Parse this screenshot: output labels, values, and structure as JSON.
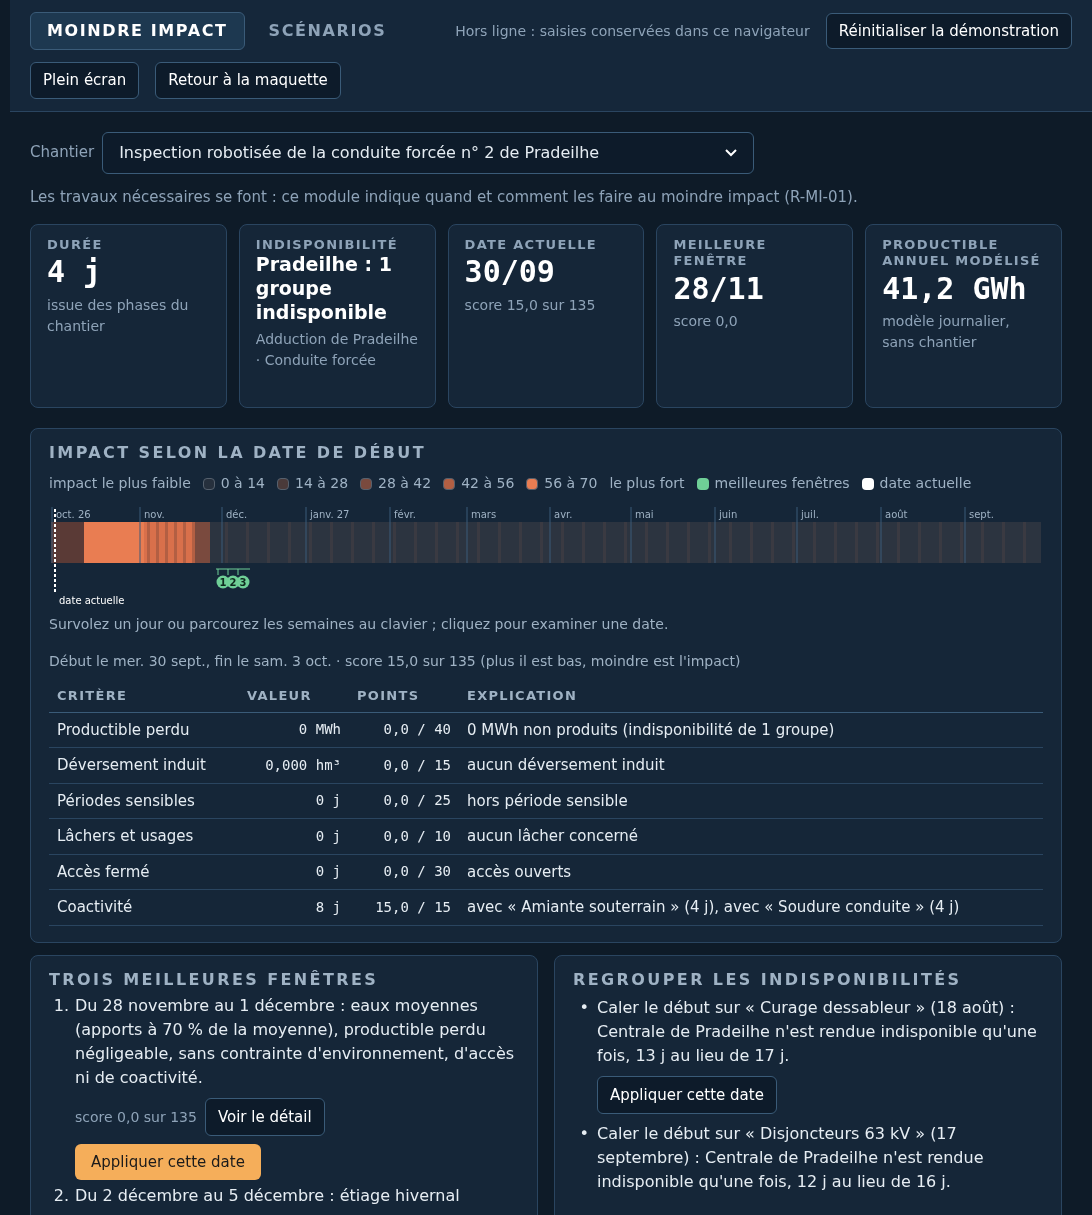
{
  "header": {
    "tabs": [
      {
        "label": "MOINDRE IMPACT",
        "selected": true
      },
      {
        "label": "SCÉNARIOS",
        "selected": false
      }
    ],
    "status": "Hors ligne : saisies conservées dans ce navigateur",
    "reset_button": "Réinitialiser la démonstration",
    "buttons": [
      "Plein écran",
      "Retour à la maquette"
    ]
  },
  "chantier": {
    "label": "Chantier",
    "value": "Inspection robotisée de la conduite forcée n° 2 de Pradeilhe"
  },
  "intro": "Les travaux nécessaires se font : ce module indique quand et comment les faire au moindre impact (R-MI-01).",
  "stats": [
    {
      "title": "DURÉE",
      "value": "4 j",
      "kind": "mono",
      "note": "issue des phases du chantier"
    },
    {
      "title": "INDISPONIBILITÉ",
      "value": "Pradeilhe : 1 groupe indisponible",
      "kind": "text",
      "note": "Adduction de Pradeilhe · Conduite forcée"
    },
    {
      "title": "DATE ACTUELLE",
      "value": "30/09",
      "kind": "mono",
      "note": "score 15,0 sur 135"
    },
    {
      "title": "MEILLEURE FENÊTRE",
      "value": "28/11",
      "kind": "mono",
      "note": "score 0,0"
    },
    {
      "title": "PRODUCTIBLE ANNUEL MODÉLISÉ",
      "value": "41,2 GWh",
      "kind": "mono",
      "note": "modèle journalier, sans chantier"
    }
  ],
  "impact": {
    "title": "IMPACT SELON LA DATE DE DÉBUT",
    "legend_low": "impact le plus faible",
    "legend_high": "le plus fort",
    "legend": [
      {
        "label": "0 à 14",
        "color": "#26303d"
      },
      {
        "label": "14 à 28",
        "color": "#4a3a3a"
      },
      {
        "label": "28 à 42",
        "color": "#7a4a3e"
      },
      {
        "label": "42 à 56",
        "color": "#b35f43"
      },
      {
        "label": "56 à 70",
        "color": "#e97d52"
      }
    ],
    "legend_extra": [
      {
        "label": "meilleures fenêtres",
        "color": "#6fcf97"
      },
      {
        "label": "date actuelle",
        "color": "#ffffff"
      }
    ],
    "months": [
      "oct. 26",
      "nov.",
      "déc.",
      "janv. 27",
      "févr.",
      "mars",
      "avr.",
      "mai",
      "juin",
      "juil.",
      "août",
      "sept."
    ],
    "window_marks": [
      "1",
      "2",
      "3"
    ],
    "current_label": "date actuelle",
    "hint": "Survolez un jour ou parcourez les semaines au clavier ; cliquez pour examiner une date.",
    "summary": "Début le mer. 30 sept., fin le sam. 3 oct. · score 15,0 sur 135 (plus il est bas, moindre est l'impact)",
    "columns": [
      "CRITÈRE",
      "VALEUR",
      "POINTS",
      "EXPLICATION"
    ],
    "rows": [
      [
        "Productible perdu",
        "0 MWh",
        "0,0 / 40",
        "0 MWh non produits (indisponibilité de 1 groupe)"
      ],
      [
        "Déversement induit",
        "0,000 hm³",
        "0,0 / 15",
        "aucun déversement induit"
      ],
      [
        "Périodes sensibles",
        "0 j",
        "0,0 / 25",
        "hors période sensible"
      ],
      [
        "Lâchers et usages",
        "0 j",
        "0,0 / 10",
        "aucun lâcher concerné"
      ],
      [
        "Accès fermé",
        "0 j",
        "0,0 / 30",
        "accès ouverts"
      ],
      [
        "Coactivité",
        "8 j",
        "15,0 / 15",
        "avec « Amiante souterrain » (4 j), avec « Soudure conduite » (4 j)"
      ]
    ]
  },
  "best_windows": {
    "title": "TROIS MEILLEURES FENÊTRES",
    "items": [
      {
        "marker": "1.",
        "text": "Du 28 novembre au 1 décembre : eaux moyennes (apports à 70 % de la moyenne), productible perdu négligeable, sans contrainte d'environnement, d'accès ni de coactivité.",
        "score": "score 0,0 sur 135",
        "detail_button": "Voir le détail",
        "apply_button": "Appliquer cette date"
      },
      {
        "marker": "2.",
        "text": "Du 2 décembre au 5 décembre : étiage hivernal"
      }
    ]
  },
  "grouping": {
    "title": "REGROUPER LES INDISPONIBILITÉS",
    "items": [
      {
        "marker": "•",
        "text": "Caler le début sur « Curage dessableur » (18 août) : Centrale de Pradeilhe n'est rendue indisponible qu'une fois, 13 j au lieu de 17 j.",
        "button": "Appliquer cette date"
      },
      {
        "marker": "•",
        "text": "Caler le début sur « Disjoncteurs 63 kV » (17 septembre) : Centrale de Pradeilhe n'est rendue indisponible qu'une fois, 12 j au lieu de 16 j."
      }
    ]
  }
}
